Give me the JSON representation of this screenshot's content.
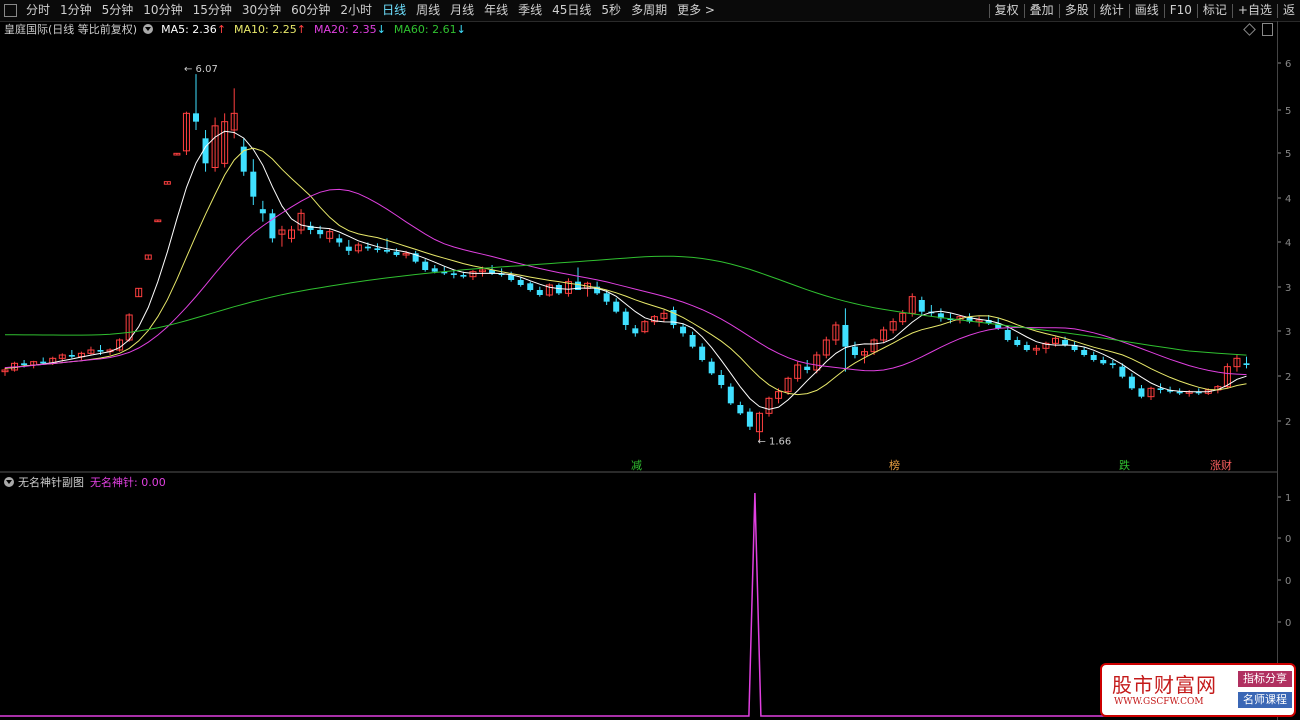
{
  "toolbar": {
    "periods": [
      "分时",
      "1分钟",
      "5分钟",
      "10分钟",
      "15分钟",
      "30分钟",
      "60分钟",
      "2小时",
      "日线",
      "周线",
      "月线",
      "年线",
      "季线",
      "45日线",
      "5秒",
      "多周期",
      "更多 >"
    ],
    "active_period": "日线",
    "right_items": [
      "复权",
      "叠加",
      "多股",
      "统计",
      "画线",
      "F10",
      "标记",
      "+自选",
      "返"
    ]
  },
  "main_legend": {
    "title": "皇庭国际(日线 等比前复权)",
    "ma5": "MA5: 2.36",
    "ma10": "MA10: 2.25",
    "ma20": "MA20: 2.35",
    "ma60": "MA60: 2.61",
    "ma5_color": "#ffffff",
    "ma10_color": "#e8e86a",
    "ma20_color": "#e040e0",
    "ma60_color": "#30c030",
    "arrow_up": "↑",
    "arrow_down": "↓"
  },
  "annotations": {
    "high": "6.07",
    "low": "1.66",
    "signal_labels": [
      "减",
      "榜",
      "跌",
      "涨财"
    ]
  },
  "right_axis_ticks": [
    "6",
    "5",
    "5",
    "4",
    "4",
    "3",
    "3",
    "2",
    "2",
    "1",
    "0",
    "0",
    "0"
  ],
  "sub_legend": {
    "title": "无名神针副图",
    "indicator": "无名神针: 0.00",
    "indicator_color": "#e040e0"
  },
  "watermark": {
    "title": "股市财富网",
    "url": "WWW.GSCFW.COM",
    "tag1": "指标分享",
    "tag2": "名师课程"
  },
  "chart_data": {
    "type": "candlestick",
    "up_color": "#ff4040",
    "down_color": "#40e0ff",
    "candles": [
      [
        2.5,
        2.55,
        2.45,
        2.52
      ],
      [
        2.52,
        2.62,
        2.5,
        2.6
      ],
      [
        2.6,
        2.64,
        2.55,
        2.58
      ],
      [
        2.58,
        2.63,
        2.54,
        2.62
      ],
      [
        2.62,
        2.67,
        2.58,
        2.6
      ],
      [
        2.6,
        2.68,
        2.58,
        2.66
      ],
      [
        2.66,
        2.72,
        2.62,
        2.7
      ],
      [
        2.7,
        2.76,
        2.66,
        2.68
      ],
      [
        2.68,
        2.74,
        2.64,
        2.72
      ],
      [
        2.72,
        2.8,
        2.7,
        2.76
      ],
      [
        2.76,
        2.82,
        2.7,
        2.74
      ],
      [
        2.74,
        2.78,
        2.7,
        2.76
      ],
      [
        2.76,
        2.9,
        2.74,
        2.88
      ],
      [
        2.88,
        3.2,
        2.86,
        3.18
      ],
      [
        3.4,
        3.5,
        3.4,
        3.5
      ],
      [
        3.85,
        3.9,
        3.85,
        3.9
      ],
      [
        4.3,
        4.32,
        4.3,
        4.32
      ],
      [
        4.75,
        4.78,
        4.75,
        4.78
      ],
      [
        5.1,
        5.12,
        5.1,
        5.12
      ],
      [
        5.15,
        5.62,
        5.1,
        5.6
      ],
      [
        5.6,
        6.07,
        5.4,
        5.5
      ],
      [
        5.3,
        5.4,
        4.9,
        5.0
      ],
      [
        4.95,
        5.55,
        4.9,
        5.45
      ],
      [
        5.0,
        5.6,
        4.95,
        5.5
      ],
      [
        5.4,
        5.9,
        5.3,
        5.6
      ],
      [
        5.2,
        5.3,
        4.85,
        4.9
      ],
      [
        4.9,
        5.05,
        4.5,
        4.6
      ],
      [
        4.45,
        4.55,
        4.3,
        4.4
      ],
      [
        4.4,
        4.45,
        4.05,
        4.1
      ],
      [
        4.15,
        4.25,
        4.0,
        4.2
      ],
      [
        4.1,
        4.25,
        4.05,
        4.2
      ],
      [
        4.2,
        4.45,
        4.15,
        4.4
      ],
      [
        4.25,
        4.3,
        4.15,
        4.2
      ],
      [
        4.2,
        4.25,
        4.1,
        4.15
      ],
      [
        4.1,
        4.22,
        4.05,
        4.18
      ],
      [
        4.1,
        4.15,
        4.0,
        4.05
      ],
      [
        4.0,
        4.08,
        3.9,
        3.95
      ],
      [
        3.95,
        4.05,
        3.92,
        4.02
      ],
      [
        4.0,
        4.05,
        3.95,
        3.98
      ],
      [
        3.98,
        4.04,
        3.93,
        3.96
      ],
      [
        3.96,
        4.1,
        3.92,
        3.94
      ],
      [
        3.94,
        3.98,
        3.88,
        3.9
      ],
      [
        3.9,
        3.95,
        3.86,
        3.92
      ],
      [
        3.92,
        3.95,
        3.8,
        3.82
      ],
      [
        3.82,
        3.85,
        3.7,
        3.72
      ],
      [
        3.74,
        3.78,
        3.68,
        3.7
      ],
      [
        3.7,
        3.76,
        3.66,
        3.68
      ],
      [
        3.68,
        3.72,
        3.62,
        3.66
      ],
      [
        3.66,
        3.7,
        3.62,
        3.64
      ],
      [
        3.64,
        3.72,
        3.6,
        3.7
      ],
      [
        3.7,
        3.76,
        3.64,
        3.72
      ],
      [
        3.72,
        3.78,
        3.66,
        3.68
      ],
      [
        3.68,
        3.74,
        3.64,
        3.66
      ],
      [
        3.66,
        3.7,
        3.58,
        3.6
      ],
      [
        3.6,
        3.64,
        3.52,
        3.54
      ],
      [
        3.56,
        3.58,
        3.46,
        3.48
      ],
      [
        3.48,
        3.52,
        3.4,
        3.42
      ],
      [
        3.42,
        3.56,
        3.4,
        3.54
      ],
      [
        3.54,
        3.56,
        3.42,
        3.44
      ],
      [
        3.44,
        3.62,
        3.4,
        3.58
      ],
      [
        3.58,
        3.75,
        3.5,
        3.48
      ],
      [
        3.5,
        3.58,
        3.4,
        3.56
      ],
      [
        3.52,
        3.58,
        3.42,
        3.44
      ],
      [
        3.44,
        3.48,
        3.3,
        3.34
      ],
      [
        3.34,
        3.38,
        3.2,
        3.22
      ],
      [
        3.22,
        3.26,
        3.0,
        3.06
      ],
      [
        3.02,
        3.06,
        2.92,
        2.96
      ],
      [
        2.98,
        3.12,
        2.96,
        3.1
      ],
      [
        3.1,
        3.18,
        3.06,
        3.16
      ],
      [
        3.14,
        3.24,
        3.1,
        3.2
      ],
      [
        3.24,
        3.28,
        3.02,
        3.06
      ],
      [
        3.04,
        3.08,
        2.92,
        2.96
      ],
      [
        2.94,
        2.98,
        2.78,
        2.8
      ],
      [
        2.8,
        2.84,
        2.62,
        2.64
      ],
      [
        2.62,
        2.66,
        2.46,
        2.48
      ],
      [
        2.46,
        2.52,
        2.3,
        2.34
      ],
      [
        2.32,
        2.36,
        2.1,
        2.12
      ],
      [
        2.1,
        2.14,
        1.98,
        2.0
      ],
      [
        2.02,
        2.06,
        1.8,
        1.84
      ],
      [
        1.78,
        2.02,
        1.66,
        2.0
      ],
      [
        2.0,
        2.2,
        1.96,
        2.18
      ],
      [
        2.18,
        2.3,
        2.12,
        2.26
      ],
      [
        2.26,
        2.44,
        2.22,
        2.42
      ],
      [
        2.42,
        2.62,
        2.38,
        2.58
      ],
      [
        2.56,
        2.64,
        2.48,
        2.52
      ],
      [
        2.52,
        2.74,
        2.48,
        2.7
      ],
      [
        2.7,
        2.92,
        2.66,
        2.88
      ],
      [
        2.88,
        3.1,
        2.82,
        3.06
      ],
      [
        3.06,
        3.26,
        2.5,
        2.8
      ],
      [
        2.8,
        2.86,
        2.66,
        2.7
      ],
      [
        2.7,
        2.78,
        2.6,
        2.74
      ],
      [
        2.74,
        2.9,
        2.7,
        2.88
      ],
      [
        2.88,
        3.04,
        2.84,
        3.0
      ],
      [
        3.0,
        3.14,
        2.96,
        3.1
      ],
      [
        3.1,
        3.24,
        3.06,
        3.2
      ],
      [
        3.2,
        3.44,
        3.16,
        3.4
      ],
      [
        3.36,
        3.4,
        3.18,
        3.22
      ],
      [
        3.22,
        3.3,
        3.16,
        3.2
      ],
      [
        3.2,
        3.26,
        3.1,
        3.14
      ],
      [
        3.14,
        3.2,
        3.08,
        3.12
      ],
      [
        3.12,
        3.18,
        3.08,
        3.16
      ],
      [
        3.16,
        3.2,
        3.08,
        3.1
      ],
      [
        3.1,
        3.16,
        3.04,
        3.12
      ],
      [
        3.12,
        3.18,
        3.06,
        3.08
      ],
      [
        3.08,
        3.14,
        3.0,
        3.02
      ],
      [
        3.0,
        3.04,
        2.86,
        2.88
      ],
      [
        2.88,
        2.92,
        2.8,
        2.82
      ],
      [
        2.82,
        2.86,
        2.74,
        2.76
      ],
      [
        2.76,
        2.82,
        2.7,
        2.78
      ],
      [
        2.78,
        2.86,
        2.72,
        2.84
      ],
      [
        2.84,
        2.92,
        2.8,
        2.9
      ],
      [
        2.88,
        2.92,
        2.8,
        2.82
      ],
      [
        2.82,
        2.86,
        2.74,
        2.76
      ],
      [
        2.76,
        2.8,
        2.68,
        2.7
      ],
      [
        2.7,
        2.74,
        2.62,
        2.64
      ],
      [
        2.64,
        2.68,
        2.58,
        2.6
      ],
      [
        2.6,
        2.64,
        2.54,
        2.58
      ],
      [
        2.56,
        2.6,
        2.42,
        2.44
      ],
      [
        2.44,
        2.48,
        2.28,
        2.3
      ],
      [
        2.3,
        2.34,
        2.18,
        2.2
      ],
      [
        2.2,
        2.32,
        2.16,
        2.3
      ],
      [
        2.3,
        2.36,
        2.24,
        2.28
      ],
      [
        2.28,
        2.32,
        2.24,
        2.26
      ],
      [
        2.26,
        2.3,
        2.22,
        2.24
      ],
      [
        2.24,
        2.28,
        2.2,
        2.26
      ],
      [
        2.26,
        2.3,
        2.22,
        2.24
      ],
      [
        2.24,
        2.3,
        2.22,
        2.28
      ],
      [
        2.28,
        2.34,
        2.24,
        2.32
      ],
      [
        2.32,
        2.6,
        2.3,
        2.56
      ],
      [
        2.56,
        2.7,
        2.5,
        2.66
      ],
      [
        2.6,
        2.68,
        2.54,
        2.58
      ]
    ],
    "sub_series_spike_index": 78,
    "sub_series_spike_value": 1.0
  }
}
